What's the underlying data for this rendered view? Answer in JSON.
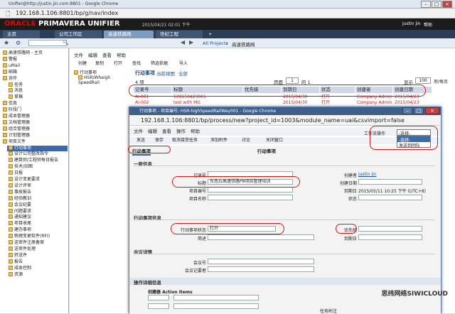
{
  "window": {
    "title": "Unifier@http://justin.jin.com:8801 - Google Chrome"
  },
  "address": {
    "url": "192.168.1.106:8801/bp/g/nav/index"
  },
  "header": {
    "brand_oracle": "ORACLE",
    "brand_product": "PRIMAVERA UNIFIER",
    "date": "2015/04/21 02:01 下午",
    "user": "justin jin",
    "help": "帮助"
  },
  "tabs": [
    {
      "label": "主页"
    },
    {
      "label": "公司工作区"
    },
    {
      "label": "高速铁路网"
    },
    {
      "label": "世纪工程"
    }
  ],
  "nav": {
    "breadcrumb_all": "All Projects",
    "breadcrumb_cur": "高速铁路网"
  },
  "menu": [
    "文件",
    "编辑",
    "查看",
    "帮助"
  ],
  "toolbar": [
    "创建",
    "复制",
    "打开",
    "查找",
    "筛选依据",
    "导入"
  ],
  "sidebar": {
    "items": [
      "高速铁路网 - 主页",
      "警报",
      "uMail",
      "邮箱",
      "协作",
      "任务",
      "消息",
      "草稿",
      "信息",
      "阶段门",
      "成本管理器",
      "文档管理器",
      "组合管理器",
      "计划管理器",
      "项目文件",
      "行动事项",
      "设计公司整改指令",
      "建筑师/工程师每日报告",
      "技术/旧图",
      "日报",
      "设计变更要求",
      "设计评审",
      "事故报告",
      "经验教训",
      "会议纪要",
      "问题要求",
      "通知建议",
      "项目收尾",
      "建办事项",
      "物理变更软件(RFI)",
      "送审件注册备案",
      "送审件处理",
      "转送件",
      "报告",
      "成本控制",
      "资源"
    ]
  },
  "tree": {
    "root": "行动事项",
    "child": "HSR/Wheigh SpeedRail"
  },
  "list": {
    "title": "行动事项",
    "view_label": "当前视图",
    "view_value": "全部",
    "count": "4 项",
    "page_label": "页面",
    "page_value": "1",
    "page_of": "的 1",
    "show_label": "显示",
    "show_value": "100",
    "per_page": "项/每页",
    "columns": [
      "记录号",
      "标题",
      "优先级",
      "到期日",
      "状态",
      "创建者",
      "创建日期"
    ],
    "rows": [
      [
        "AI-001",
        "120150423001",
        "",
        "2015/04/30",
        "打开",
        "Company Admin",
        "2015/04/23"
      ],
      [
        "AI-002",
        "test with MG",
        "",
        "2015/04/30",
        "打开",
        "Company Admin",
        "2015/04/23"
      ]
    ]
  },
  "popup": {
    "title": "行动事项 - 项目编号: HSR-highSpeedRailWay001 - Google Chrome",
    "url": "192.168.1.106:8801/bp/process/new?project_id=1003&module_name=uai&csvimport=false",
    "menu": [
      "文件",
      "编辑",
      "查看",
      "操作",
      "帮助"
    ],
    "toolbar": [
      "发送",
      "保存",
      "取消接受任务",
      "添加附件",
      "讨论",
      "关闭窗口"
    ],
    "tab_label": "行动事项",
    "header_label": "行动事项",
    "workflow_label": "工作流操作",
    "workflow_select": "-选择-",
    "workflow_options": [
      "-选择-",
      "发送到团队"
    ],
    "general_section": "一般信息",
    "record_no_label": "记录号",
    "title_label": "标题",
    "title_value": "东南丘高速铁路P8项目管理培训",
    "project_no_label": "项目编号",
    "project_name_label": "项目名称",
    "creator_label": "创建者",
    "creator_value": "justin jin",
    "created_date_label": "创建日期",
    "due_date_label": "到期日",
    "due_date_value": "2015/05/11 10:25 下午 (UTC+8)",
    "status_label": "状态",
    "action_section": "行动事项信息",
    "action_status_label": "行动事项状态",
    "action_status_value": "打开",
    "priority_label": "优先级",
    "description_label": "简述",
    "due_label": "到期日",
    "meeting_section": "会议详情",
    "meeting_no_label": "会议号",
    "meeting_recorder_label": "会议记要者",
    "ops_section": "操作详细信息",
    "create_action_label": "创建器 Action Items",
    "assigned_label": "任务附注"
  },
  "watermark": "思纬网络SIWICLOUD"
}
